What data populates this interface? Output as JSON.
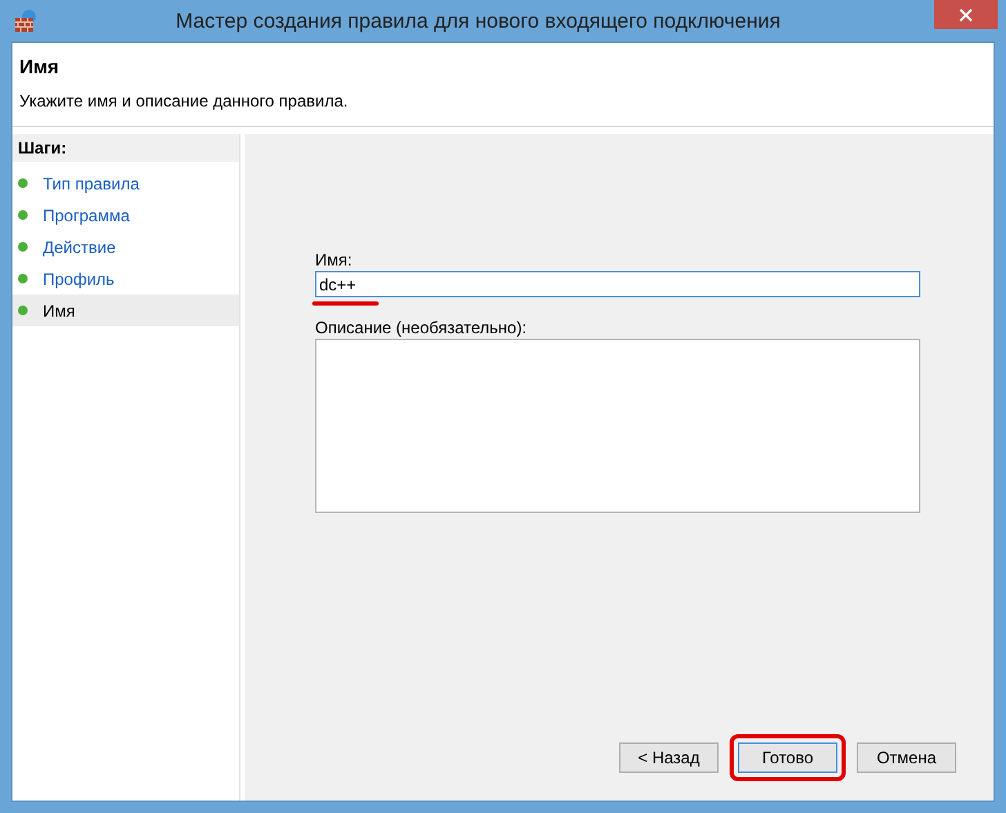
{
  "window": {
    "title": "Мастер создания правила для нового входящего подключения"
  },
  "header": {
    "title": "Имя",
    "subtitle": "Укажите имя и описание данного правила."
  },
  "steps": {
    "title": "Шаги:",
    "items": [
      {
        "label": "Тип правила",
        "selected": false
      },
      {
        "label": "Программа",
        "selected": false
      },
      {
        "label": "Действие",
        "selected": false
      },
      {
        "label": "Профиль",
        "selected": false
      },
      {
        "label": "Имя",
        "selected": true
      }
    ]
  },
  "form": {
    "name_label": "Имя:",
    "name_value": "dc++",
    "name_underlined": true,
    "description_label": "Описание (необязательно):"
  },
  "buttons": [
    {
      "label": "< Назад",
      "default": false,
      "highlighted": false
    },
    {
      "label": "Готово",
      "default": true,
      "highlighted": true
    },
    {
      "label": "Отмена",
      "default": false,
      "highlighted": false
    }
  ]
}
